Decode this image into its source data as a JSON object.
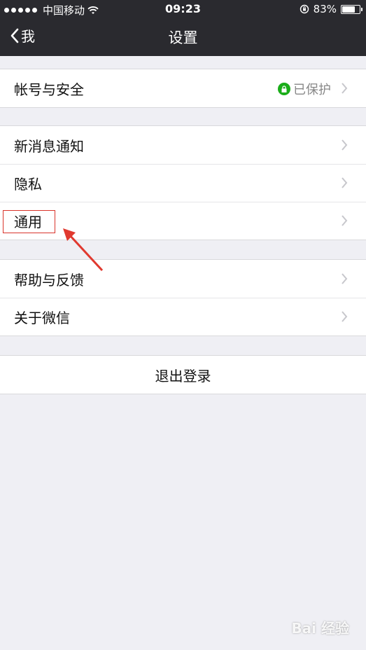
{
  "status_bar": {
    "carrier": "中国移动",
    "time": "09:23",
    "battery": "83%",
    "battery_level": 0.83
  },
  "nav": {
    "back_label": "我",
    "title": "设置"
  },
  "groups": [
    {
      "items": [
        {
          "label": "帐号与安全",
          "value": "已保护"
        }
      ]
    },
    {
      "items": [
        {
          "label": "新消息通知"
        },
        {
          "label": "隐私"
        },
        {
          "label": "通用"
        }
      ]
    },
    {
      "items": [
        {
          "label": "帮助与反馈"
        },
        {
          "label": "关于微信"
        }
      ]
    }
  ],
  "logout_label": "退出登录",
  "watermark": "Bai 经验",
  "colors": {
    "nav_bg": "#2a2a2f",
    "page_bg": "#efeff4",
    "lock_green": "#1aad19",
    "annotation_red": "#d9342b"
  }
}
